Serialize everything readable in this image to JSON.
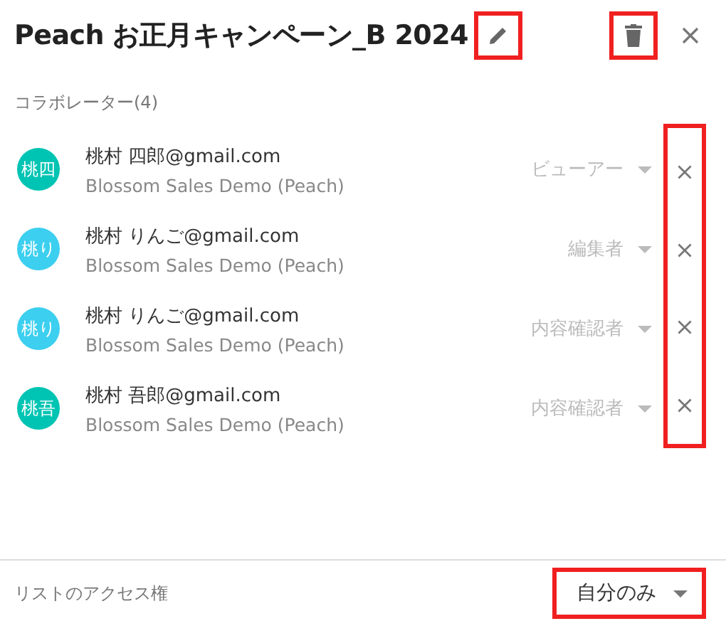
{
  "header": {
    "title": "Peach お正月キャンペーン_B 2024",
    "edit_highlighted": true,
    "delete_highlighted": true
  },
  "collaborators": {
    "label": "コラボレーター(4)",
    "remove_highlighted": true,
    "items": [
      {
        "initials": "桃四",
        "color": "#00c4b3",
        "email": "桃村 四郎@gmail.com",
        "org": "Blossom Sales Demo (Peach)",
        "role": "ビューアー",
        "disabled": true
      },
      {
        "initials": "桃り",
        "color": "#3ccfef",
        "email": "桃村 りんご@gmail.com",
        "org": "Blossom Sales Demo (Peach)",
        "role": "編集者",
        "disabled": true
      },
      {
        "initials": "桃り",
        "color": "#3ccfef",
        "email": "桃村 りんご@gmail.com",
        "org": "Blossom Sales Demo (Peach)",
        "role": "内容確認者",
        "disabled": true
      },
      {
        "initials": "桃吾",
        "color": "#00c4b3",
        "email": "桃村 吾郎@gmail.com",
        "org": "Blossom Sales Demo (Peach)",
        "role": "内容確認者",
        "disabled": true
      }
    ]
  },
  "footer": {
    "label": "リストのアクセス権",
    "access": "自分のみ",
    "access_highlighted": true
  }
}
